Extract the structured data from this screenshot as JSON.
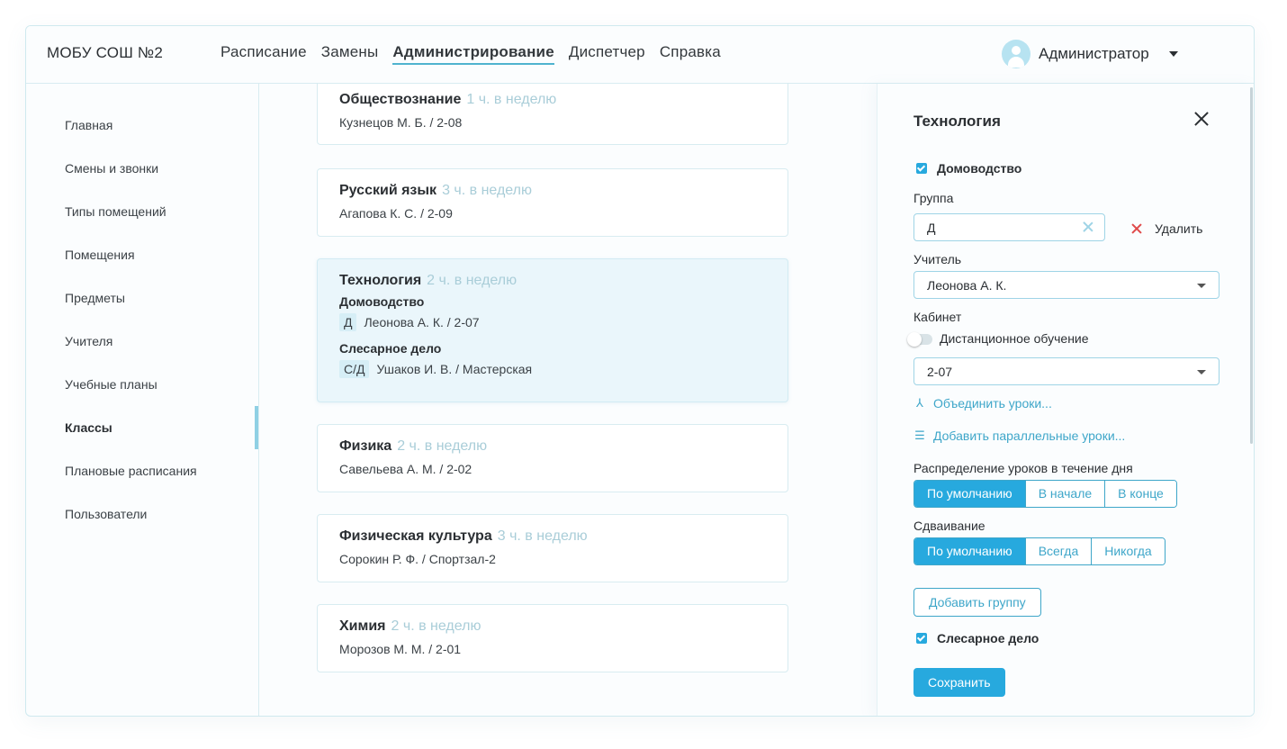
{
  "header": {
    "school": "МОБУ СОШ №2",
    "nav": [
      "Расписание",
      "Замены",
      "Администрирование",
      "Диспетчер",
      "Справка"
    ],
    "active_nav": "Администрирование",
    "user": "Администратор"
  },
  "sidebar": {
    "items": [
      "Главная",
      "Смены и звонки",
      "Типы помещений",
      "Помещения",
      "Предметы",
      "Учителя",
      "Учебные планы",
      "Классы",
      "Плановые расписания",
      "Пользователи"
    ],
    "active": "Классы"
  },
  "cards": [
    {
      "title": "Обществознание",
      "hours": "1 ч. в неделю",
      "line": "Кузнецов М. Б. / 2-08"
    },
    {
      "title": "Русский язык",
      "hours": "3 ч. в неделю",
      "line": "Агапова К. С. / 2-09"
    },
    {
      "title": "Технология",
      "hours": "2 ч. в неделю",
      "groups": [
        {
          "name": "Домоводство",
          "tag": "Д",
          "line": "Леонова А. К. / 2-07"
        },
        {
          "name": "Слесарное дело",
          "tag": "С/Д",
          "line": "Ушаков И. В. / Мастерская"
        }
      ]
    },
    {
      "title": "Физика",
      "hours": "2 ч. в неделю",
      "line": "Савельева А. М. / 2-02"
    },
    {
      "title": "Физическая культура",
      "hours": "3 ч. в неделю",
      "line": "Сорокин Р. Ф. / Спортзал-2"
    },
    {
      "title": "Химия",
      "hours": "2 ч. в неделю",
      "line": "Морозов М. М. / 2-01"
    }
  ],
  "panel": {
    "title": "Технология",
    "group1_check": "Домоводство",
    "group_label": "Группа",
    "group_value": "Д",
    "delete_label": "Удалить",
    "teacher_label": "Учитель",
    "teacher_value": "Леонова  А. К.",
    "room_label": "Кабинет",
    "remote_label": "Дистанционное обучение",
    "room_value": "2-07",
    "merge_link": "Объединить уроки...",
    "parallel_link": "Добавить параллельные уроки...",
    "distribution_label": "Распределение уроков в течение дня",
    "distribution_options": [
      "По умолчанию",
      "В начале",
      "В конце"
    ],
    "pairing_label": "Сдваивание",
    "pairing_options": [
      "По умолчанию",
      "Всегда",
      "Никогда"
    ],
    "add_group": "Добавить группу",
    "group2_check": "Слесарное дело",
    "save": "Сохранить",
    "colors": {
      "accent": "#27a9de",
      "link": "#3ea6c9",
      "danger": "#e04a4a"
    }
  }
}
